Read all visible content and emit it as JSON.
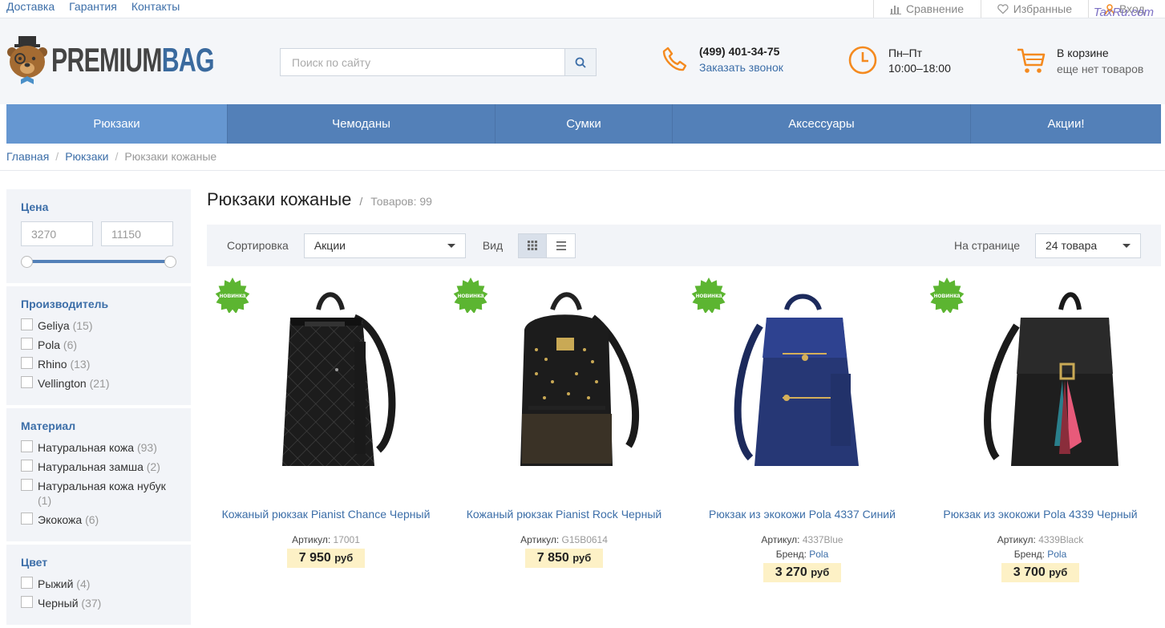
{
  "topbar": {
    "links": [
      "Доставка",
      "Гарантия",
      "Контакты"
    ],
    "compare": "Сравнение",
    "favorites": "Избранные",
    "login": "Вход",
    "watermark": "TaxRu.com"
  },
  "header": {
    "logo_part1": "PREMIUM",
    "logo_part2": "BAG",
    "search_placeholder": "Поиск по сайту",
    "phone": "(499) 401-34-75",
    "callback": "Заказать звонок",
    "hours_days": "Пн–Пт",
    "hours_time": "10:00–18:00",
    "cart_title": "В корзине",
    "cart_status": "еще нет товаров"
  },
  "nav": [
    "Рюкзаки",
    "Чемоданы",
    "Сумки",
    "Аксессуары",
    "Акции!"
  ],
  "breadcrumb": {
    "home": "Главная",
    "section": "Рюкзаки",
    "current": "Рюкзаки кожаные",
    "sep": "/"
  },
  "filters": {
    "price_title": "Цена",
    "price_min": "3270",
    "price_max": "11150",
    "brand_title": "Производитель",
    "brands": [
      {
        "label": "Geliya",
        "count": "(15)"
      },
      {
        "label": "Pola",
        "count": "(6)"
      },
      {
        "label": "Rhino",
        "count": "(13)"
      },
      {
        "label": "Vellington",
        "count": "(21)"
      }
    ],
    "material_title": "Материал",
    "materials": [
      {
        "label": "Натуральная кожа",
        "count": "(93)"
      },
      {
        "label": "Натуральная замша",
        "count": "(2)"
      },
      {
        "label": "Натуральная кожа нубук",
        "count": "(1)"
      },
      {
        "label": "Экокожа",
        "count": "(6)"
      }
    ],
    "color_title": "Цвет",
    "colors": [
      {
        "label": "Рыжий",
        "count": "(4)"
      },
      {
        "label": "Черный",
        "count": "(37)"
      }
    ]
  },
  "main": {
    "title": "Рюкзаки кожаные",
    "title_sep": "/",
    "count": "Товаров: 99",
    "sort_label": "Сортировка",
    "sort_value": "Акции",
    "view_label": "Вид",
    "per_page_label": "На странице",
    "per_page_value": "24 товара"
  },
  "products": [
    {
      "badge": "новинка",
      "name": "Кожаный рюкзак Pianist Chance Черный",
      "sku_label": "Артикул:",
      "sku": "17001",
      "price": "7 950",
      "currency": "руб"
    },
    {
      "badge": "новинка",
      "name": "Кожаный рюкзак Pianist Rock Черный",
      "sku_label": "Артикул:",
      "sku": "G15B0614",
      "price": "7 850",
      "currency": "руб"
    },
    {
      "badge": "новинка",
      "name": "Рюкзак из экокожи Pola 4337 Синий",
      "sku_label": "Артикул:",
      "sku": "4337Blue",
      "brand_label": "Бренд:",
      "brand": "Pola",
      "price": "3 270",
      "currency": "руб"
    },
    {
      "badge": "новинка",
      "name": "Рюкзак из экокожи Pola 4339 Черный",
      "sku_label": "Артикул:",
      "sku": "4339Black",
      "brand_label": "Бренд:",
      "brand": "Pola",
      "price": "3 700",
      "currency": "руб"
    }
  ],
  "colors": {
    "accent": "#5380b8",
    "nav_active": "#6697d1",
    "link": "#3c6ea8",
    "orange": "#f48a1f",
    "badge_green": "#5cb531",
    "price_bg": "#fdf1c6"
  }
}
